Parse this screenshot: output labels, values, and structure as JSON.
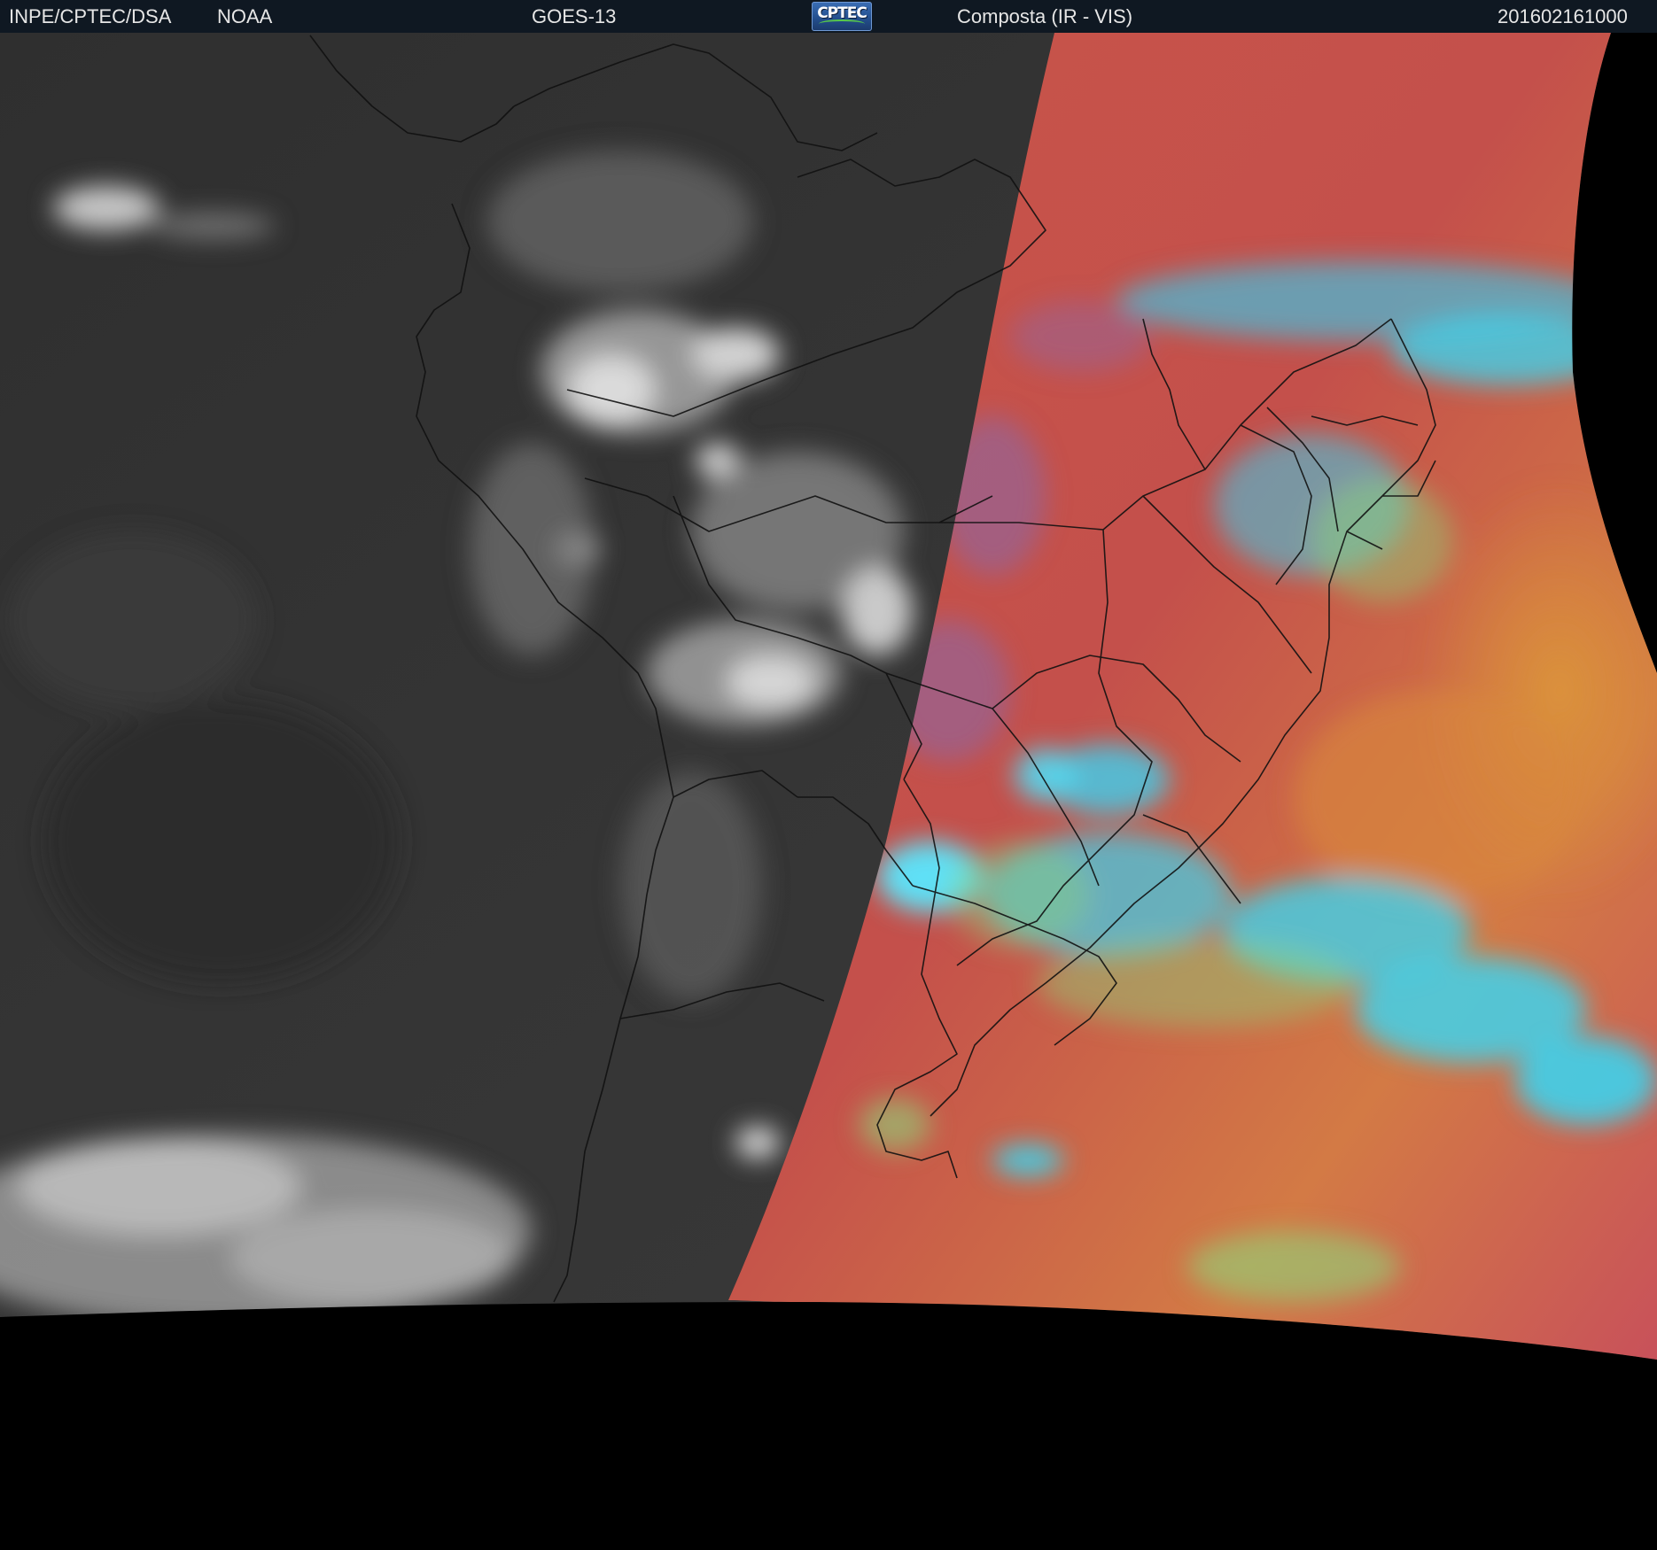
{
  "header": {
    "source": "INPE/CPTEC/DSA",
    "agency": "NOAA",
    "satellite": "GOES-13",
    "logo_text": "CPTEC",
    "product": "Composta (IR - VIS)",
    "timestamp": "201602161000"
  },
  "colors": {
    "header_background": "#0f1822",
    "header_text": "#e6e6e6",
    "ir_dark": "#2d2d2d",
    "ir_cloud": "#cfcfcf",
    "vis_surface_red": "#c0534d",
    "vis_ocean_orange": "#d8853e",
    "vis_cloud_cyan": "#3fd2ec",
    "vis_cloud_green": "#8fd57a",
    "space_background": "#000000",
    "border_lines": "#111111"
  },
  "icons": {
    "logo": "cptec-logo"
  }
}
